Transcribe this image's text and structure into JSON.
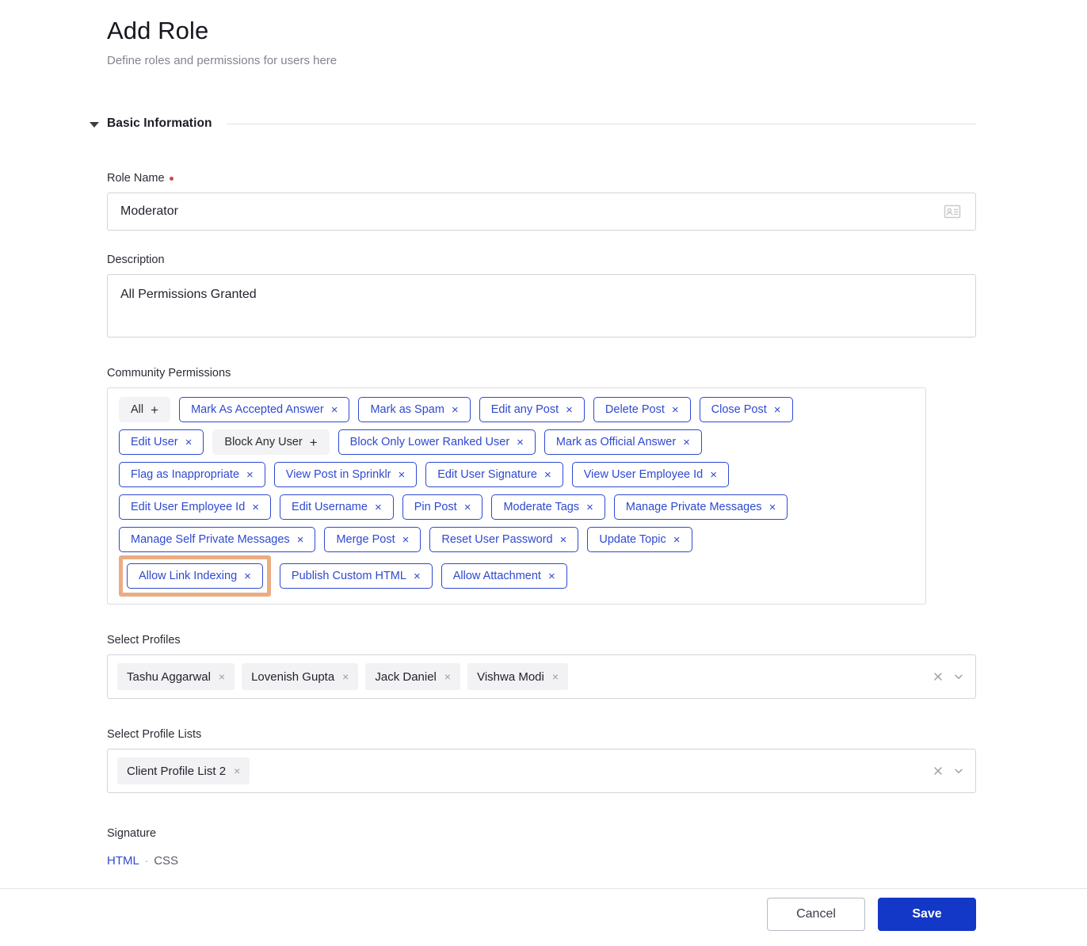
{
  "header": {
    "title": "Add Role",
    "subtitle": "Define roles and permissions for users here"
  },
  "section": {
    "title": "Basic Information",
    "caret_icon": "caret-down-icon"
  },
  "role_name": {
    "label": "Role Name",
    "required": true,
    "value": "Moderator",
    "icon": "id-card-icon"
  },
  "description": {
    "label": "Description",
    "value": "All Permissions Granted"
  },
  "community_permissions": {
    "label": "Community Permissions",
    "highlighted_chip": "Allow Link Indexing",
    "accent_selected": "#2f49d1",
    "accent_highlight": "#eaad83",
    "rows": [
      [
        {
          "label": "All",
          "state": "unselected",
          "action": "+"
        },
        {
          "label": "Mark As Accepted Answer",
          "state": "selected",
          "action": "×"
        },
        {
          "label": "Mark as Spam",
          "state": "selected",
          "action": "×"
        },
        {
          "label": "Edit any Post",
          "state": "selected",
          "action": "×"
        },
        {
          "label": "Delete Post",
          "state": "selected",
          "action": "×"
        },
        {
          "label": "Close Post",
          "state": "selected",
          "action": "×"
        }
      ],
      [
        {
          "label": "Edit User",
          "state": "selected",
          "action": "×"
        },
        {
          "label": "Block Any User",
          "state": "unselected",
          "action": "+"
        },
        {
          "label": "Block Only Lower Ranked User",
          "state": "selected",
          "action": "×"
        },
        {
          "label": "Mark as Official Answer",
          "state": "selected",
          "action": "×"
        }
      ],
      [
        {
          "label": "Flag as Inappropriate",
          "state": "selected",
          "action": "×"
        },
        {
          "label": "View Post in Sprinklr",
          "state": "selected",
          "action": "×"
        },
        {
          "label": "Edit User Signature",
          "state": "selected",
          "action": "×"
        },
        {
          "label": "View User Employee Id",
          "state": "selected",
          "action": "×"
        }
      ],
      [
        {
          "label": "Edit User Employee Id",
          "state": "selected",
          "action": "×"
        },
        {
          "label": "Edit Username",
          "state": "selected",
          "action": "×"
        },
        {
          "label": "Pin Post",
          "state": "selected",
          "action": "×"
        },
        {
          "label": "Moderate Tags",
          "state": "selected",
          "action": "×"
        },
        {
          "label": "Manage Private Messages",
          "state": "selected",
          "action": "×"
        }
      ],
      [
        {
          "label": "Manage Self Private Messages",
          "state": "selected",
          "action": "×"
        },
        {
          "label": "Merge Post",
          "state": "selected",
          "action": "×"
        },
        {
          "label": "Reset User Password",
          "state": "selected",
          "action": "×"
        },
        {
          "label": "Update Topic",
          "state": "selected",
          "action": "×"
        }
      ],
      [
        {
          "label": "Allow Link Indexing",
          "state": "selected",
          "action": "×",
          "highlighted": true
        },
        {
          "label": "Publish Custom HTML",
          "state": "selected",
          "action": "×"
        },
        {
          "label": "Allow Attachment",
          "state": "selected",
          "action": "×"
        }
      ]
    ]
  },
  "select_profiles": {
    "label": "Select Profiles",
    "tags": [
      "Tashu Aggarwal",
      "Lovenish Gupta",
      "Jack Daniel",
      "Vishwa Modi"
    ],
    "clear_icon": "close-icon",
    "chevron_icon": "chevron-down-icon"
  },
  "select_profile_lists": {
    "label": "Select Profile Lists",
    "tags": [
      "Client Profile List 2"
    ],
    "clear_icon": "close-icon",
    "chevron_icon": "chevron-down-icon"
  },
  "signature": {
    "label": "Signature",
    "html_link": "HTML",
    "separator": "·",
    "css_link": "CSS"
  },
  "footer": {
    "cancel_label": "Cancel",
    "save_label": "Save",
    "save_color": "#1337c6"
  }
}
